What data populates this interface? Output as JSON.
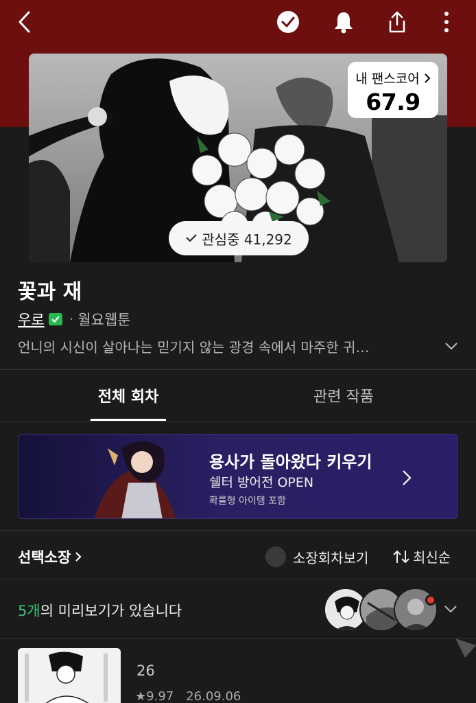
{
  "header": {
    "back_icon": "chevron-left-icon",
    "actions": [
      "check-circle-icon",
      "bell-icon",
      "share-icon",
      "more-vertical-icon"
    ]
  },
  "fanscore": {
    "label": "내 팬스코어",
    "value": "67.9"
  },
  "interest": {
    "label": "관심중 41,292"
  },
  "work": {
    "title": "꽃과 재",
    "author": "우로",
    "separator": "·",
    "weekday": "월요웹툰",
    "synopsis": "언니의 시신이 살아나는 믿기지 않는 광경 속에서 마주한 귀…"
  },
  "tabs": [
    {
      "label": "전체 회차",
      "active": true
    },
    {
      "label": "관련 작품",
      "active": false
    }
  ],
  "banner": {
    "title": "용사가 돌아왔다 키우기",
    "subtitle": "쉘터 방어전 OPEN",
    "note": "확률형 아이템 포함"
  },
  "controls": {
    "select_buy": "선택소장",
    "owned_toggle": "소장회차보기",
    "sort": "최신순"
  },
  "preview": {
    "count": "5개",
    "text": "의 미리보기가 있습니다"
  },
  "episode": {
    "number": "26",
    "rating": "9.97",
    "date": "26.09.06"
  },
  "colors": {
    "header_bg": "#6d0f0f",
    "page_bg": "#1b1b1b",
    "accent_green": "#3cc47a",
    "badge_red": "#e53935"
  }
}
